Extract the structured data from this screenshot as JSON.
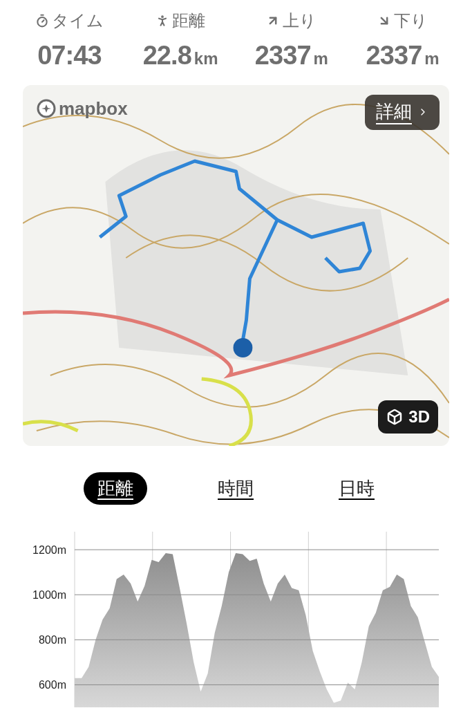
{
  "stats": [
    {
      "kind": "time",
      "label": "タイム",
      "value": "07:43"
    },
    {
      "kind": "distance",
      "label": "距離",
      "value": "22.8",
      "unit": "km"
    },
    {
      "kind": "ascent",
      "label": "上り",
      "value": "2337",
      "unit": "m"
    },
    {
      "kind": "descent",
      "label": "下り",
      "value": "2337",
      "unit": "m"
    }
  ],
  "map": {
    "attribution": "mapbox",
    "details_button": "詳細",
    "view_3d_button": "3D"
  },
  "tabs": [
    {
      "label": "距離",
      "selected": true
    },
    {
      "label": "時間",
      "selected": false
    },
    {
      "label": "日時",
      "selected": false
    }
  ],
  "elevation": {
    "chart_data": {
      "type": "area",
      "ylim": [
        500,
        1280
      ],
      "yticks": [
        {
          "value": 600,
          "label": "600m"
        },
        {
          "value": 800,
          "label": "800m"
        },
        {
          "value": 1000,
          "label": "1000m"
        },
        {
          "value": 1200,
          "label": "1200m"
        }
      ],
      "grid": true,
      "series": [
        {
          "color": "#8f8f8f",
          "values": [
            630,
            630,
            680,
            800,
            890,
            940,
            1070,
            1090,
            1050,
            970,
            1040,
            1155,
            1145,
            1185,
            1180,
            1030,
            870,
            700,
            570,
            650,
            830,
            950,
            1100,
            1185,
            1180,
            1150,
            1160,
            1050,
            970,
            1050,
            1090,
            1030,
            1020,
            910,
            750,
            660,
            580,
            520,
            530,
            610,
            580,
            700,
            860,
            920,
            1020,
            1035,
            1090,
            1070,
            950,
            900,
            790,
            680,
            635
          ]
        }
      ]
    }
  }
}
